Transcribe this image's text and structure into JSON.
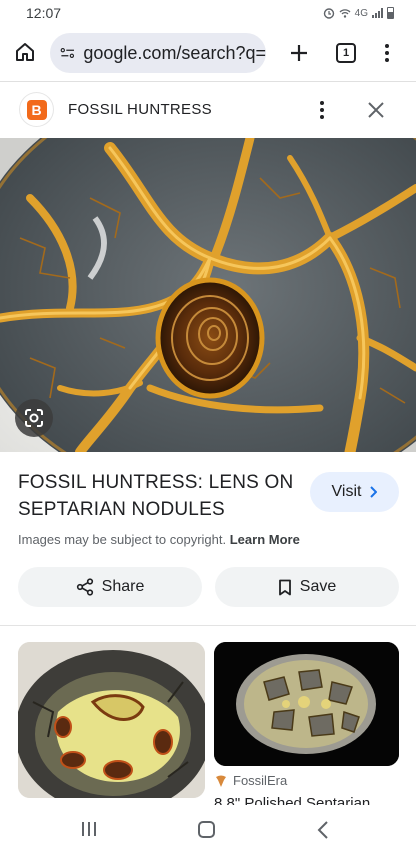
{
  "status_bar": {
    "time": "12:07",
    "network": "4G"
  },
  "browser": {
    "url": "google.com/search?q=",
    "tab_count": "1"
  },
  "source": {
    "logo_letter": "B",
    "name": "FOSSIL HUNTRESS"
  },
  "result": {
    "title": "FOSSIL HUNTRESS: LENS ON SEPTARIAN NODULES",
    "visit_label": "Visit",
    "copyright_text": "Images may be subject to copyright.",
    "learn_more": "Learn More"
  },
  "actions": {
    "share_label": "Share",
    "save_label": "Save"
  },
  "related": [
    {
      "name": "related-image-1"
    },
    {
      "source": "FossilEra",
      "title": "8.8\" Polished Septarian"
    }
  ],
  "colors": {
    "accent_visit_bg": "#e8f0fe",
    "blogger_orange": "#f26a1b",
    "action_bg": "#f1f3f4"
  },
  "icons": [
    "home-icon",
    "site-settings-icon",
    "plus-icon",
    "tabs-icon",
    "menu-icon",
    "more-icon",
    "close-icon",
    "lens-icon",
    "chevron-right-icon",
    "share-icon",
    "bookmark-icon",
    "fossilera-icon"
  ]
}
